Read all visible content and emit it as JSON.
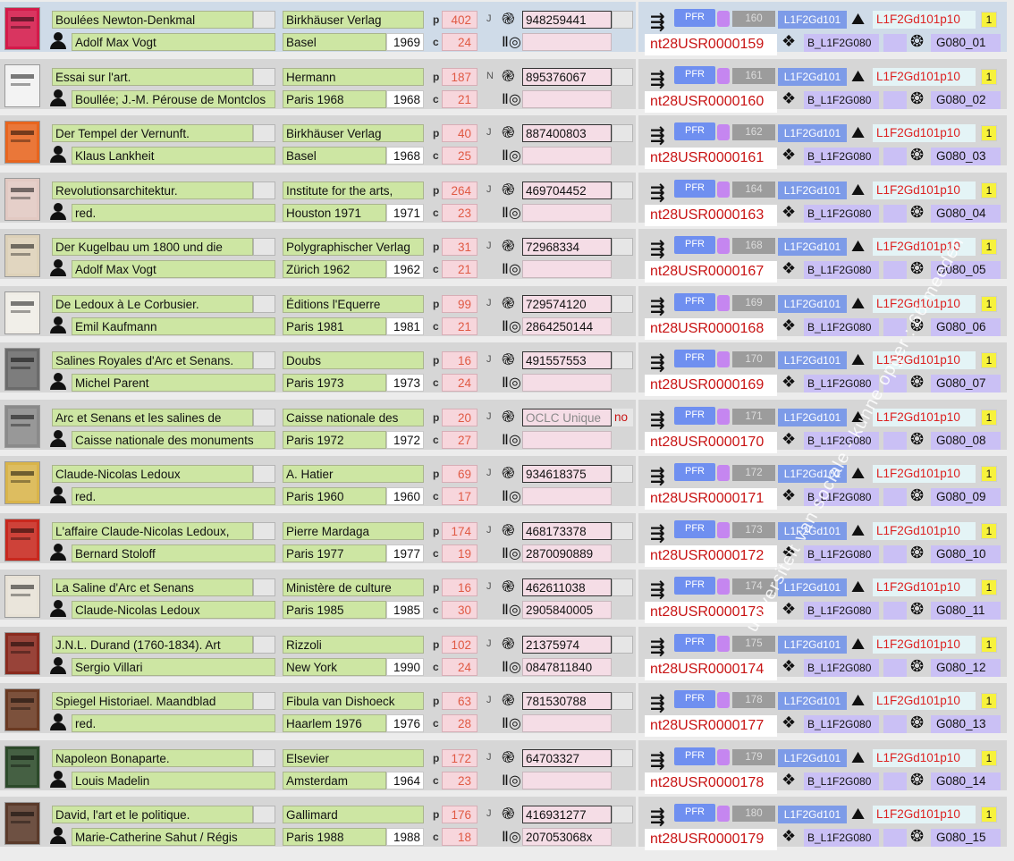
{
  "labels": {
    "p": "p",
    "c": "c",
    "pfr": "PFR",
    "l1": "L1F2Gd101",
    "l1p": "L1F2Gd101p10",
    "one": "1",
    "drop": "B_L1F2G080"
  },
  "icons": {
    "worldcat": "worldcat-logo-icon",
    "barcode": "barcode-search-icon",
    "route": "route-arrow-icon",
    "map": "map-pin-icon",
    "dropbox": "dropbox-icon",
    "aperture": "camera-aperture-icon",
    "person": "person-icon"
  },
  "colors": {
    "title_field": "#cde6a3",
    "pages_field": "#f7d6dc",
    "pfr": "#6f8ff0",
    "user_id": "#c81414",
    "location": "#cac0f5"
  },
  "records": [
    {
      "title": "Boulées Newton-Denkmal",
      "author": "Adolf Max Vogt",
      "publisher": "Birkhäuser Verlag",
      "place": "Basel",
      "year": "1969",
      "pages": "402",
      "c": "24",
      "lang": "J",
      "oclc": "948259441",
      "isbn": "",
      "num": "160",
      "user": "nt28USR0000159",
      "loc": "G080_01",
      "thumb": "#d41a4a"
    },
    {
      "title": "Essai sur l'art.",
      "author": "Boullée; J.-M. Pérouse de Montclos",
      "publisher": "Hermann",
      "place": "Paris 1968",
      "year": "1968",
      "pages": "187",
      "c": "21",
      "lang": "N",
      "oclc": "895376067",
      "isbn": "",
      "num": "161",
      "user": "nt28USR0000160",
      "loc": "G080_02",
      "thumb": "#f2f2f2"
    },
    {
      "title": "Der Tempel der Vernunft.",
      "author": "Klaus Lankheit",
      "publisher": "Birkhäuser Verlag",
      "place": "Basel",
      "year": "1968",
      "pages": "40",
      "c": "25",
      "lang": "J",
      "oclc": "887400803",
      "isbn": "",
      "num": "162",
      "user": "nt28USR0000161",
      "loc": "G080_03",
      "thumb": "#e8651e"
    },
    {
      "title": "Revolutionsarchitektur.",
      "author": "red.",
      "publisher": "Institute for the arts,",
      "place": "Houston 1971",
      "year": "1971",
      "pages": "264",
      "c": "23",
      "lang": "J",
      "oclc": "469704452",
      "isbn": "",
      "num": "164",
      "user": "nt28USR0000163",
      "loc": "G080_04",
      "thumb": "#e2c9c2"
    },
    {
      "title": "Der Kugelbau um 1800 und die",
      "author": "Adolf Max Vogt",
      "publisher": "Polygraphischer Verlag",
      "place": "Zürich  1962",
      "year": "1962",
      "pages": "31",
      "c": "21",
      "lang": "J",
      "oclc": "72968334",
      "isbn": "",
      "num": "168",
      "user": "nt28USR0000167",
      "loc": "G080_05",
      "thumb": "#ddd1b8"
    },
    {
      "title": "De Ledoux à Le Corbusier.",
      "author": "Emil Kaufmann",
      "publisher": "Éditions l'Equerre",
      "place": "Paris 1981",
      "year": "1981",
      "pages": "99",
      "c": "21",
      "lang": "J",
      "oclc": "729574120",
      "isbn": "2864250144",
      "num": "169",
      "user": "nt28USR0000168",
      "loc": "G080_06",
      "thumb": "#f0ede6"
    },
    {
      "title": "Salines Royales d'Arc et Senans.",
      "author": "Michel Parent",
      "publisher": "Doubs",
      "place": "Paris 1973",
      "year": "1973",
      "pages": "16",
      "c": "24",
      "lang": "J",
      "oclc": "491557553",
      "isbn": "",
      "num": "170",
      "user": "nt28USR0000169",
      "loc": "G080_07",
      "thumb": "#6b6b6b"
    },
    {
      "title": "Arc et Senans et les salines de",
      "author": "Caisse nationale des monuments",
      "publisher": "Caisse nationale des",
      "place": "Paris 1972",
      "year": "1972",
      "pages": "20",
      "c": "27",
      "lang": "J",
      "oclc": "OCLC Unique",
      "oclc_no": "no",
      "isbn": "",
      "num": "171",
      "user": "nt28USR0000170",
      "loc": "G080_08",
      "thumb": "#8a8a8a"
    },
    {
      "title": "Claude-Nicolas Ledoux",
      "author": "red.",
      "publisher": "A. Hatier",
      "place": "Paris   1960",
      "year": "1960",
      "pages": "69",
      "c": "17",
      "lang": "J",
      "oclc": "934618375",
      "isbn": "",
      "num": "172",
      "user": "nt28USR0000171",
      "loc": "G080_09",
      "thumb": "#d9b44a"
    },
    {
      "title": "L'affaire Claude-Nicolas Ledoux,",
      "author": "Bernard Stoloff",
      "publisher": "Pierre Mardaga",
      "place": "Paris  1977",
      "year": "1977",
      "pages": "174",
      "c": "19",
      "lang": "J",
      "oclc": "468173378",
      "isbn": "2870090889",
      "num": "173",
      "user": "nt28USR0000172",
      "loc": "G080_10",
      "thumb": "#c8281e"
    },
    {
      "title": "La Saline d'Arc et Senans",
      "author": "Claude-Nicolas Ledoux",
      "publisher": "Ministère de culture",
      "place": "Paris   1985",
      "year": "1985",
      "pages": "16",
      "c": "30",
      "lang": "J",
      "oclc": "462611038",
      "isbn": "2905840005",
      "num": "174",
      "user": "nt28USR0000173",
      "loc": "G080_11",
      "thumb": "#e8e2d6"
    },
    {
      "title": "J.N.L. Durand (1760-1834). Art",
      "author": "Sergio Villari",
      "publisher": "Rizzoli",
      "place": "New York",
      "year": "1990",
      "pages": "102",
      "c": "24",
      "lang": "J",
      "oclc": "21375974",
      "isbn": "0847811840",
      "num": "175",
      "user": "nt28USR0000174",
      "loc": "G080_12",
      "thumb": "#8a2a1e"
    },
    {
      "title": "Spiegel Historiael. Maandblad",
      "author": "red.",
      "publisher": "Fibula van Dishoeck",
      "place": "Haarlem  1976",
      "year": "1976",
      "pages": "63",
      "c": "28",
      "lang": "J",
      "oclc": "781530788",
      "isbn": "",
      "num": "178",
      "user": "nt28USR0000177",
      "loc": "G080_13",
      "thumb": "#6a3a22"
    },
    {
      "title": "Napoleon Bonaparte.",
      "author": "Louis Madelin",
      "publisher": "Elsevier",
      "place": "Amsterdam",
      "year": "1964",
      "pages": "172",
      "c": "23",
      "lang": "J",
      "oclc": "64703327",
      "isbn": "",
      "num": "179",
      "user": "nt28USR0000178",
      "loc": "G080_14",
      "thumb": "#2c4a2a"
    },
    {
      "title": "David, l'art et le politique.",
      "author": "Marie-Catherine Sahut / Régis",
      "publisher": "Gallimard",
      "place": "Paris  1988",
      "year": "1988",
      "pages": "176",
      "c": "18",
      "lang": "J",
      "oclc": "416931277",
      "isbn": "207053068x",
      "num": "180",
      "user": "nt28USR0000179",
      "loc": "G080_15",
      "thumb": "#5a3a2a"
    }
  ],
  "watermark": "universiteit van sociale - kunne opger : 66 meeden"
}
